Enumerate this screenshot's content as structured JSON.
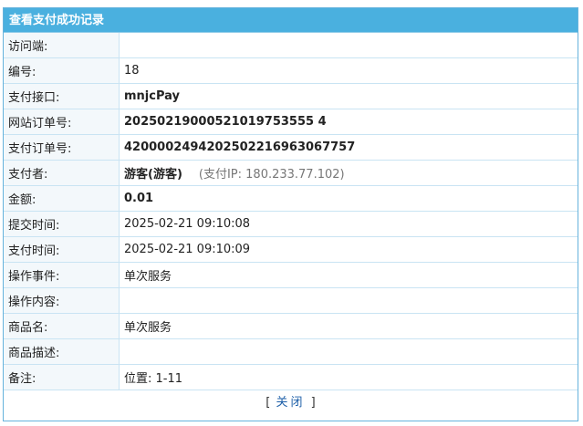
{
  "panel": {
    "title": "查看支付成功记录"
  },
  "rows": [
    {
      "label": "访问端:",
      "value": ""
    },
    {
      "label": "编号:",
      "value": "18"
    },
    {
      "label": "支付接口:",
      "value": "mnjcPay"
    },
    {
      "label": "网站订单号:",
      "value": "20250219000521019753555 4"
    },
    {
      "label": "支付订单号:",
      "value": "4200002494202502216963067757"
    },
    {
      "label": "支付者:",
      "value": "游客(游客)",
      "note": "(支付IP: 180.233.77.102)"
    },
    {
      "label": "金额:",
      "value": "0.01"
    },
    {
      "label": "提交时间:",
      "value": "2025-02-21 09:10:08"
    },
    {
      "label": "支付时间:",
      "value": "2025-02-21 09:10:09"
    },
    {
      "label": "操作事件:",
      "value": "单次服务"
    },
    {
      "label": "操作内容:",
      "value": ""
    },
    {
      "label": "商品名:",
      "value": "单次服务"
    },
    {
      "label": "商品描述:",
      "value": ""
    },
    {
      "label": "备注:",
      "value": "位置: 1-11"
    }
  ],
  "footer": {
    "open_bracket": "[",
    "close_label": "关闭",
    "close_bracket": "]"
  },
  "colors": {
    "title_bar": "#4ab0df",
    "border": "#66b3dc",
    "link": "#1d5fa8"
  }
}
